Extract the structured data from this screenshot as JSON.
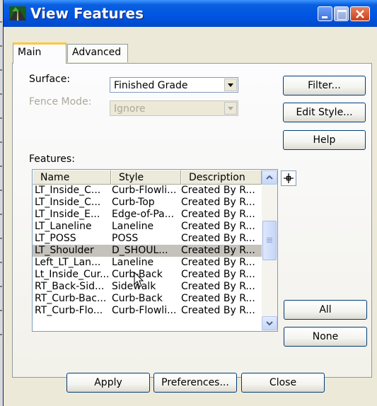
{
  "window": {
    "title": "View Features",
    "minimize_icon": "minimize-icon",
    "maximize_icon": "maximize-icon",
    "close_icon": "close-icon"
  },
  "tabs": [
    {
      "label": "Main",
      "selected": true
    },
    {
      "label": "Advanced",
      "selected": false
    }
  ],
  "surface": {
    "label": "Surface:",
    "value": "Finished Grade"
  },
  "fence_mode": {
    "label": "Fence Mode:",
    "value": "Ignore",
    "disabled": true
  },
  "side_buttons": {
    "filter": "Filter...",
    "edit_style": "Edit Style...",
    "help": "Help"
  },
  "features": {
    "label": "Features:",
    "columns": [
      "Name",
      "Style",
      "Description"
    ],
    "rows": [
      {
        "name": "LT_Inside_C...",
        "style": "Curb-Flowli...",
        "desc": "Created By R..."
      },
      {
        "name": "LT_Inside_C...",
        "style": "Curb-Top",
        "desc": "Created By R..."
      },
      {
        "name": "LT_Inside_E...",
        "style": "Edge-of-Pa...",
        "desc": "Created By R..."
      },
      {
        "name": "LT_Laneline",
        "style": "Laneline",
        "desc": "Created By R..."
      },
      {
        "name": "LT_POSS",
        "style": "POSS",
        "desc": "Created By R..."
      },
      {
        "name": "LT_Shoulder",
        "style": "D_SHOUL...",
        "desc": "Created By R...",
        "selected": true
      },
      {
        "name": "Left_LT_Lan...",
        "style": "Laneline",
        "desc": "Created By R..."
      },
      {
        "name": "Lt_Inside_Cur...",
        "style": "Curb-Back",
        "desc": "Created By R..."
      },
      {
        "name": "RT_Back-Sid...",
        "style": "Sidewalk",
        "desc": "Created By R..."
      },
      {
        "name": "RT_Curb-Bac...",
        "style": "Curb-Back",
        "desc": "Created By R..."
      },
      {
        "name": "RT_Curb-Flo...",
        "style": "Curb-Flowli...",
        "desc": "Created By R..."
      }
    ],
    "locate_icon": "crosshair-locate-icon"
  },
  "selection_buttons": {
    "all": "All",
    "none": "None"
  },
  "footer_buttons": {
    "apply": "Apply",
    "preferences": "Preferences...",
    "close": "Close"
  },
  "colors": {
    "titlebar": "#0054e3",
    "dialog_bg": "#ece9d8",
    "selected_row": "#c5c2bc"
  }
}
